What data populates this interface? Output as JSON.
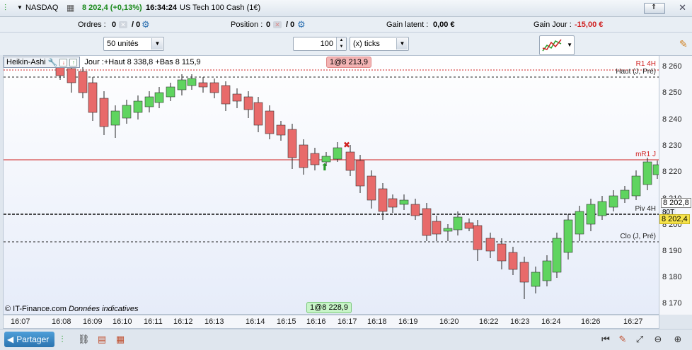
{
  "topbar": {
    "instrument": "NASDAQ",
    "price_change": "8 202,4 (+0,13%)",
    "time": "16:34:24",
    "instrument_full": "US Tech 100 Cash (1€)"
  },
  "infobar": {
    "orders_label": "Ordres :",
    "orders_count": "0",
    "orders_pending": "/ 0",
    "position_label": "Position :",
    "position_count": "0",
    "position_pending": "/ 0",
    "latent_label": "Gain latent :",
    "latent_value": "0,00 €",
    "day_label": "Gain Jour :",
    "day_value": "-15,00 €"
  },
  "controls": {
    "units": "50 unités",
    "quantity": "100",
    "mode": "(x) ticks"
  },
  "chart": {
    "indicator": "Heikin-Ashi",
    "day_info": "Jour :+Haut 8 338,8 +Bas 8 115,9",
    "order_top": "1@8 213,9",
    "order_bottom": "1@8 228,9",
    "copyright": "© IT-Finance.com",
    "disclaimer": "Données indicatives",
    "lines": [
      {
        "label": "R1 4H",
        "color": "#d02020"
      },
      {
        "label": "Haut (J, Pré)",
        "color": "#222"
      },
      {
        "label": "mR1 J",
        "color": "#d02020"
      },
      {
        "label": "Piv 4H",
        "color": "#222"
      },
      {
        "label": "Clo (J, Pré)",
        "color": "#222"
      }
    ],
    "current_price": "8 202,8",
    "current_price_tag": "80T",
    "cursor_price": "8 202,4",
    "price_ticks": [
      "8 260",
      "8 250",
      "8 240",
      "8 230",
      "8 220",
      "8 210",
      "8 200",
      "8 190",
      "8 180",
      "8 170"
    ],
    "time_ticks": [
      "16:07",
      "16:08",
      "16:09",
      "16:10",
      "16:11",
      "16:12",
      "16:13",
      "16:14",
      "16:15",
      "16:16",
      "16:17",
      "16:18",
      "16:19",
      "16:20",
      "16:22",
      "16:23",
      "16:24",
      "16:26",
      "16:27"
    ],
    "colors": {
      "bull": "#5fd45f",
      "bear": "#e86a6a"
    }
  },
  "bottombar": {
    "share_label": "Partager"
  }
}
